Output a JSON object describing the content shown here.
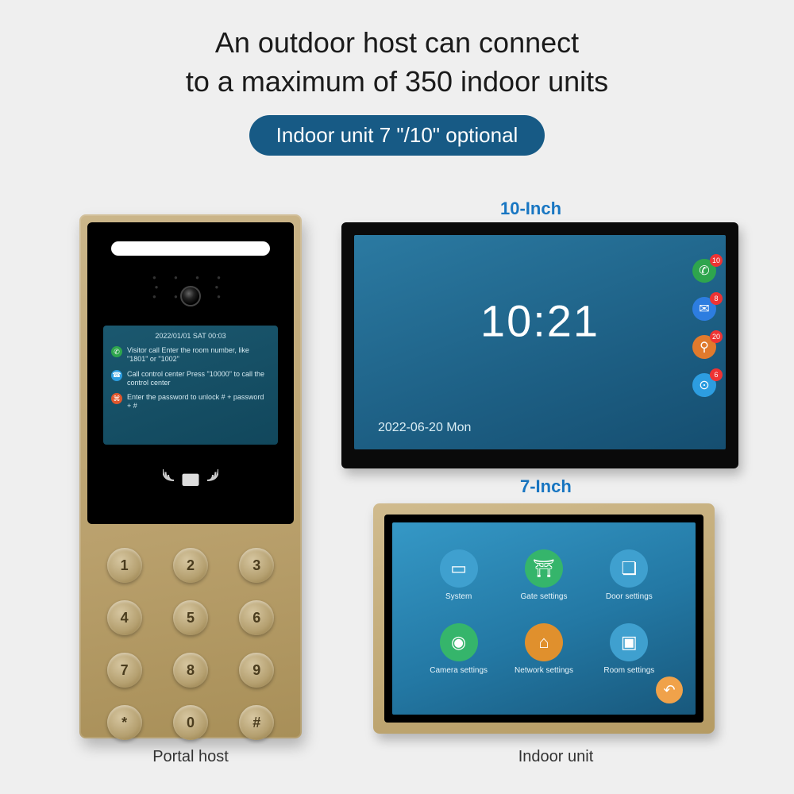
{
  "header": {
    "title_line1": "An outdoor host can connect",
    "title_line2": "to a maximum of 350 indoor units",
    "pill": "Indoor unit 7 \"/10\" optional"
  },
  "labels": {
    "ten_inch": "10-Inch",
    "seven_inch": "7-Inch",
    "portal_caption": "Portal host",
    "indoor_caption": "Indoor unit"
  },
  "portal": {
    "screen_date": "2022/01/01 SAT 00:03",
    "line1": "Visitor call\nEnter the room number, like \"1801\" or \"1002\"",
    "line2": "Call control center\nPress \"10000\" to call the control center",
    "line3": "Enter the password to unlock\n# + password + #",
    "keys": [
      "1",
      "2",
      "3",
      "4",
      "5",
      "6",
      "7",
      "8",
      "9",
      "*",
      "0",
      "#"
    ]
  },
  "unit10": {
    "clock": "10:21",
    "date": "2022-06-20  Mon",
    "side_icons": [
      {
        "name": "phone-icon",
        "bg": "#2ea54d",
        "badge": "10"
      },
      {
        "name": "message-icon",
        "bg": "#2d7de0",
        "badge": "8"
      },
      {
        "name": "person-icon",
        "bg": "#e07a2d",
        "badge": "20"
      },
      {
        "name": "camera-icon",
        "bg": "#2d9de0",
        "badge": "6"
      }
    ]
  },
  "unit7": {
    "apps": [
      {
        "name": "system-icon",
        "bg": "#3fa0cf",
        "label": "System"
      },
      {
        "name": "gate-settings-icon",
        "bg": "#35b56b",
        "label": "Gate settings"
      },
      {
        "name": "door-settings-icon",
        "bg": "#3fa0cf",
        "label": "Door settings"
      },
      {
        "name": "camera-settings-icon",
        "bg": "#35b56b",
        "label": "Camera settings"
      },
      {
        "name": "network-settings-icon",
        "bg": "#e0902d",
        "label": "Network settings"
      },
      {
        "name": "room-settings-icon",
        "bg": "#3fa0cf",
        "label": "Room settings"
      }
    ]
  }
}
